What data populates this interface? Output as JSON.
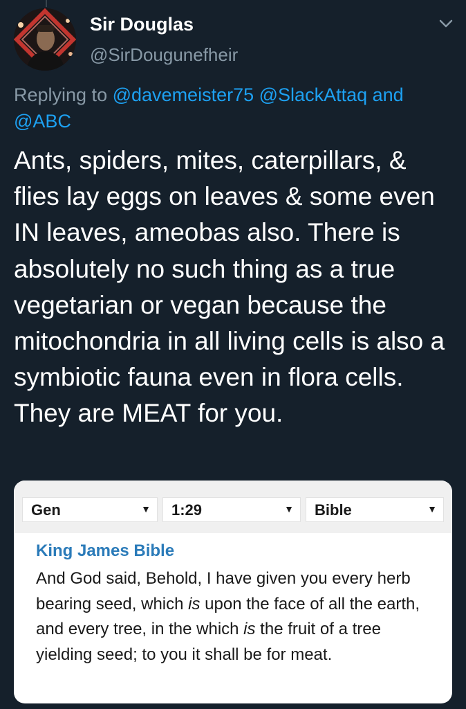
{
  "tweet": {
    "author_name": "Sir Douglas",
    "author_handle": "@SirDougunefheir",
    "replying_prefix": "Replying to",
    "mentions": [
      "@davemeister75",
      "@SlackAttaq"
    ],
    "mentions_conjunction": "and",
    "last_mention": "@ABC",
    "text": "Ants, spiders, mites, caterpillars, & flies lay eggs on leaves & some even IN leaves, ameobas also. There is absolutely no such thing as a true vegetarian or vegan because the mitochondria in all living cells is also a symbiotic fauna even in flora cells. They are MEAT for you.",
    "menu_icon": "chevron-down-icon",
    "avatar_icon": "avatar"
  },
  "image_card": {
    "selectors": [
      {
        "value": "Gen"
      },
      {
        "value": "1:29"
      },
      {
        "value": "Bible"
      }
    ],
    "version_title": "King James Bible",
    "verse_parts": [
      "And God said, Behold, I have given you every herb bearing seed, which ",
      "is",
      " upon the face of all the earth, and every tree, in the which ",
      "is",
      " the fruit of a tree yielding seed; to you it shall be for meat."
    ]
  },
  "colors": {
    "background": "#15202b",
    "secondary_text": "#8899a6",
    "link": "#1da1f2",
    "bible_title": "#2b7bb9"
  }
}
